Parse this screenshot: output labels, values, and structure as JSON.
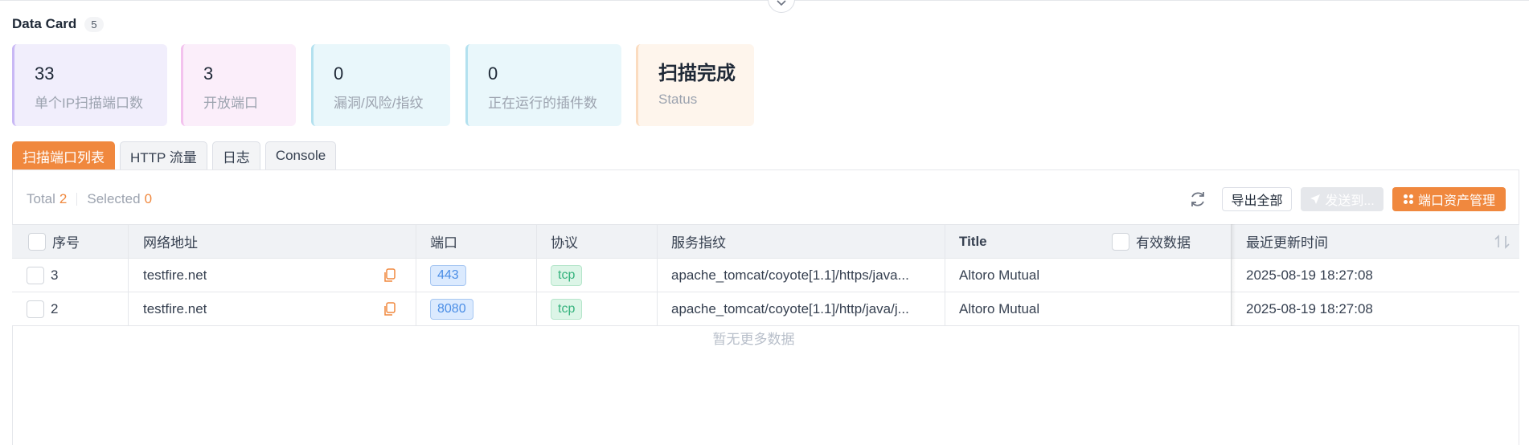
{
  "header": {
    "title": "Data Card",
    "count": "5"
  },
  "stats": [
    {
      "value": "33",
      "label": "单个IP扫描端口数"
    },
    {
      "value": "3",
      "label": "开放端口"
    },
    {
      "value": "0",
      "label": "漏洞/风险/指纹"
    },
    {
      "value": "0",
      "label": "正在运行的插件数"
    },
    {
      "value": "扫描完成",
      "label": "Status"
    }
  ],
  "tabs": [
    "扫描端口列表",
    "HTTP 流量",
    "日志",
    "Console"
  ],
  "toolbar": {
    "total_label": "Total",
    "total_value": "2",
    "selected_label": "Selected",
    "selected_value": "0",
    "export_label": "导出全部",
    "send_label": "发送到...",
    "manage_label": "端口资产管理"
  },
  "table": {
    "columns": {
      "index": "序号",
      "address": "网络地址",
      "port": "端口",
      "protocol": "协议",
      "fingerprint": "服务指纹",
      "title": "Title",
      "valid_data": "有效数据",
      "updated": "最近更新时间"
    },
    "rows": [
      {
        "index": "3",
        "address": "testfire.net",
        "port": "443",
        "protocol": "tcp",
        "fingerprint": "apache_tomcat/coyote[1.1]/https/java...",
        "title": "Altoro Mutual",
        "updated": "2025-08-19 18:27:08"
      },
      {
        "index": "2",
        "address": "testfire.net",
        "port": "8080",
        "protocol": "tcp",
        "fingerprint": "apache_tomcat/coyote[1.1]/http/java/j...",
        "title": "Altoro Mutual",
        "updated": "2025-08-19 18:27:08"
      }
    ],
    "empty_text": "暂无更多数据"
  },
  "colors": {
    "accent": "#f0883e",
    "port_tag": "#4b8ee6",
    "tcp_tag": "#36b37e"
  }
}
